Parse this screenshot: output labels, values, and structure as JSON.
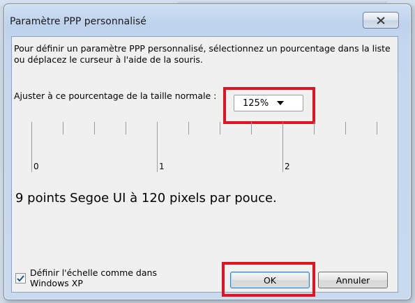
{
  "window": {
    "title": "Paramètre PPP personnalisé",
    "close_icon": "close-x-icon"
  },
  "content": {
    "intro": "Pour définir un paramètre PPP personnalisé, sélectionnez un pourcentage dans la liste ou déplacez le curseur à l'aide de la souris.",
    "adjust_label": "Ajuster à ce pourcentage de la taille normale :",
    "scale_dropdown": {
      "value": "125%"
    },
    "ruler": {
      "labels": [
        "0",
        "1",
        "2"
      ]
    },
    "info_text": "9 points Segoe UI à 120 pixels par pouce."
  },
  "footer": {
    "xp_scaling_checkbox": {
      "label": "Définir l'échelle comme dans Windows XP",
      "checked": true
    },
    "ok_label": "OK",
    "cancel_label": "Annuler"
  },
  "highlight_color": "#e0141e"
}
